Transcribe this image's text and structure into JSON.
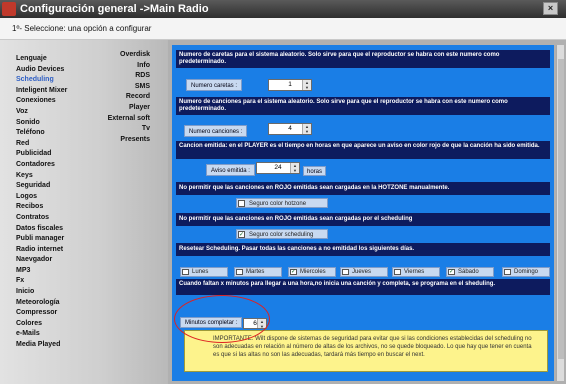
{
  "window": {
    "title": "Configuración general ->Main Radio",
    "close_glyph": "×"
  },
  "subheader": "1º- Seleccione: una opción a configurar",
  "sidebar": {
    "left_items": [
      "Lenguaje",
      "Audio Devices",
      "Scheduling",
      "Inteligent Mixer",
      "Conexiones",
      "Voz",
      "Sonido",
      "Teléfono",
      "Red",
      "Publicidad",
      "Contadores",
      "Keys",
      "Seguridad",
      "Logos",
      "Recibos",
      "Contratos",
      "Datos fiscales",
      "Publi manager",
      "Radio internet",
      "Naevgador",
      "MP3",
      "Fx",
      "Inicio",
      "Meteorología",
      "Compressor",
      "Colores",
      "e-Mails",
      "Media Played"
    ],
    "right_items": [
      "Overdisk",
      "Info",
      "RDS",
      "SMS",
      "Record",
      "Player",
      "External soft",
      "Tv",
      "Presents"
    ],
    "active": "Scheduling",
    "active_color": "#2f5fc4"
  },
  "panel": {
    "bg_color": "#1a7ee6",
    "notice_caretas": "Numero de caretas para el sistema aleatorio. Solo sirve para que el reproductor se habra con este numero como   predeterminado.",
    "label_caretas": "Numero caretas :",
    "value_caretas": "1",
    "notice_canciones": "Numero de canciones para el sistema aleatorio. Solo sirve para que el reproductor se habra con este numero como   predeterminado.",
    "label_canciones": "Numero canciones :",
    "value_canciones": "4",
    "notice_aviso": "Cancion emitida: en el PLAYER es el tiempo en horas en que aparece un aviso en color rojo  de que la canción ha sido emitida.",
    "label_aviso": "Aviso emitida :",
    "value_aviso": "24",
    "unit_aviso": "horas",
    "notice_hotzone": "No permitir que las canciones en ROJO emitidas sean cargadas en la HOTZONE manualmente.",
    "check_hotzone": "Seguro color hotzone",
    "notice_scheduling": "No permitir que las canciones en ROJO emitidas sean cargadas por el scheduling",
    "check_scheduling": "Seguro color scheduling",
    "check_scheduling_checked": true,
    "notice_reset": "Resetear Scheduling. Pasar todas las canciones a no emitidad los siguientes días.",
    "days": [
      {
        "label": "Lunes",
        "checked": false
      },
      {
        "label": "Martes",
        "checked": false
      },
      {
        "label": "Miercoles",
        "checked": true
      },
      {
        "label": "Jueves",
        "checked": false
      },
      {
        "label": "Viernes",
        "checked": false
      },
      {
        "label": "Sábado",
        "checked": true
      },
      {
        "label": "Domingo",
        "checked": false
      }
    ],
    "notice_minutos": "Cuando faltan x minutos para llegar a una hora,no inicia una canción y completa, se programa en el sheduling.",
    "label_minutos": "Minutos completar :",
    "value_minutos": "6",
    "important_text": "IMPORTANTE: Wilt dispone de  sistemas de seguridad para evitar que si las condiciones establecidas del scheduling no son adecuadas en relación al número de altas de los archivos, no se quede bloqueado. Lo que hay que tener en cuenta es que si las altas no son las adecuadas, tardará más tiempo en buscar el next.",
    "check_glyph": "✓",
    "up_glyph": "▲",
    "down_glyph": "▼"
  }
}
